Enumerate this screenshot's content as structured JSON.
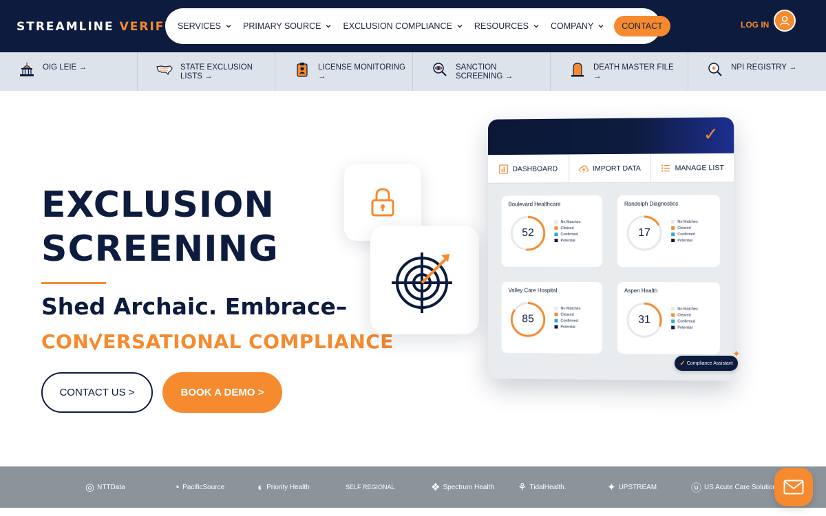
{
  "header": {
    "logo_part1": "STREAMLINE",
    "logo_part2": "VERIFY",
    "nav": [
      {
        "label": "SERVICES"
      },
      {
        "label": "PRIMARY SOURCE"
      },
      {
        "label": "EXCLUSION COMPLIANCE"
      },
      {
        "label": "RESOURCES"
      },
      {
        "label": "COMPANY"
      }
    ],
    "contact_label": "CONTACT",
    "login_label": "LOG IN"
  },
  "subnav": [
    {
      "label": "OIG LEIE →",
      "icon": "capitol-icon"
    },
    {
      "label": "STATE EXCLUSION LISTS →",
      "icon": "us-map-icon"
    },
    {
      "label": "LICENSE MONITORING →",
      "icon": "id-badge-icon"
    },
    {
      "label": "SANCTION SCREENING →",
      "icon": "eye-search-icon"
    },
    {
      "label": "DEATH MASTER FILE →",
      "icon": "tombstone-icon"
    },
    {
      "label": "NPI REGISTRY →",
      "icon": "registry-search-icon"
    }
  ],
  "hero": {
    "title_line1": "EXCLUSION",
    "title_line2": "SCREENING",
    "tagline": "Shed Archaic. Embrace–",
    "conv_a": "CON",
    "conv_b": "ERSATIONAL COMPLIANCE",
    "tm": "™",
    "contact_button": "CONTACT US  >",
    "demo_button": "BOOK A DEMO  >"
  },
  "dashboard": {
    "tabs": [
      {
        "label": "DASHBOARD",
        "icon": "bar-chart-icon"
      },
      {
        "label": "IMPORT DATA",
        "icon": "cloud-upload-icon"
      },
      {
        "label": "MANAGE LIST",
        "icon": "list-icon"
      }
    ],
    "cards": [
      {
        "name": "Boulevard Healthcare",
        "value": "52",
        "level": 0.52
      },
      {
        "name": "Randolph Diagnostics",
        "value": "17",
        "level": 0.17
      },
      {
        "name": "Valley Care Hospital",
        "value": "85",
        "level": 0.85
      },
      {
        "name": "Aspen Health",
        "value": "31",
        "level": 0.31
      }
    ],
    "legend": [
      {
        "label": "No Matches",
        "color": "#e6e8eb"
      },
      {
        "label": "Cleared",
        "color": "#f58a2e"
      },
      {
        "label": "Confirmed",
        "color": "#29a8d8"
      },
      {
        "label": "Potential",
        "color": "#0d1b3e"
      }
    ],
    "assistant_label": "Compliance Assistant",
    "assistant_mark": "✓"
  },
  "clients": [
    {
      "label": "NTTData",
      "icon": "◎"
    },
    {
      "label": "PacificSource",
      "icon": "◔"
    },
    {
      "label": "Priority Health",
      "icon": "◐"
    },
    {
      "label": "SELF REGIONAL",
      "icon": ""
    },
    {
      "label": "Spectrum Health",
      "icon": "❖"
    },
    {
      "label": "TidalHealth.",
      "icon": "⚘"
    },
    {
      "label": "UPSTREAM",
      "icon": "✦"
    },
    {
      "label": "US Acute Care Solutions",
      "icon": "ⓤ"
    }
  ],
  "colors": {
    "navy": "#0d1b3e",
    "orange": "#f58a2e",
    "subnav_bg": "#dde3ea",
    "logobar_bg": "#8b939b"
  }
}
